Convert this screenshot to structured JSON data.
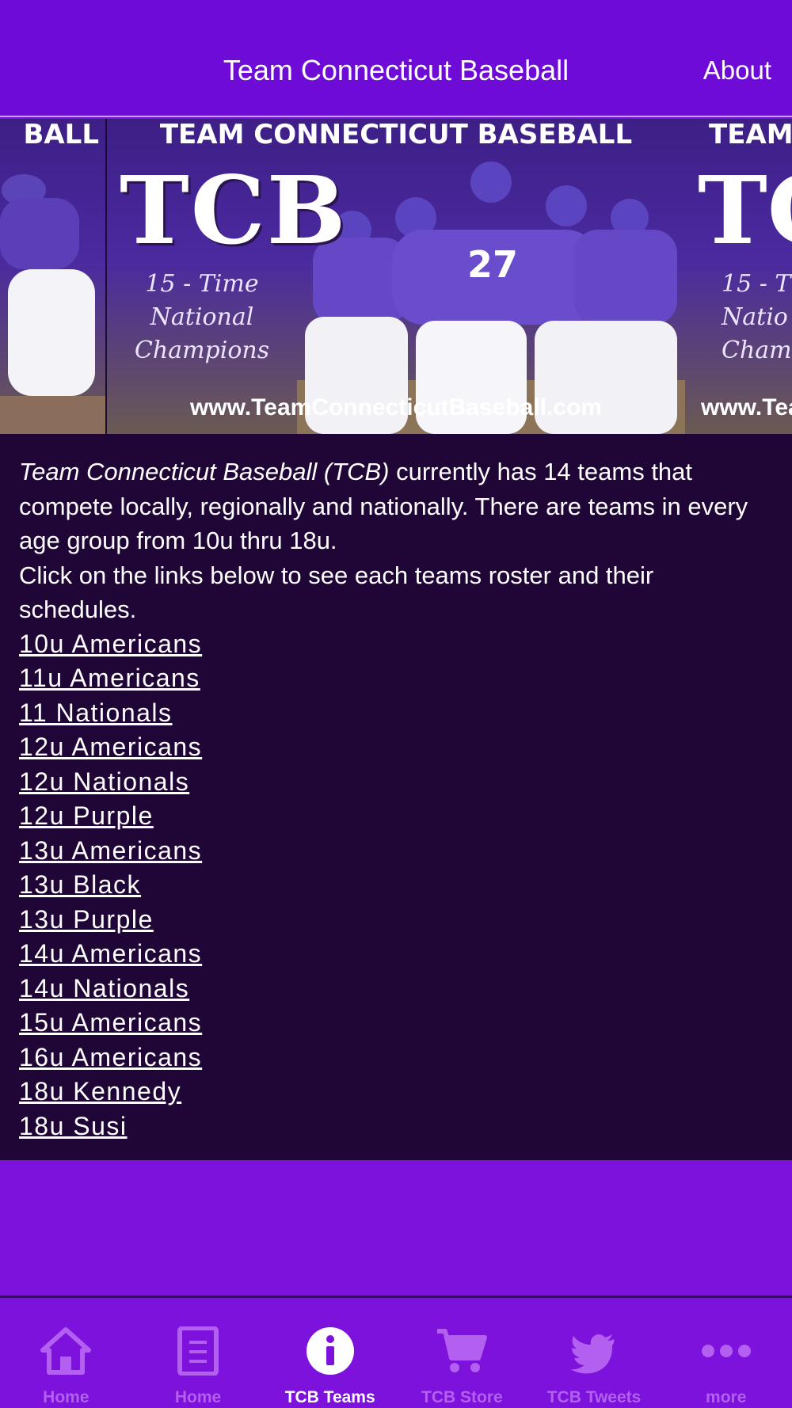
{
  "header": {
    "title": "Team Connecticut Baseball",
    "about_label": "About"
  },
  "banner": {
    "headline": "TEAM CONNECTICUT BASEBALL",
    "logo": "TCB",
    "tagline_lines": [
      "15 - Time",
      "National",
      "Champions"
    ],
    "url": "www.TeamConnecticutBaseball.com",
    "jersey_number": "27",
    "left_edge_text": "BALL",
    "right_edge_text": "TEAM",
    "right_logo": "TC",
    "right_tag_lines": [
      "15 - T",
      "Natio",
      "Champ"
    ],
    "right_url": "www.Tea"
  },
  "intro": {
    "brand": "Team Connecticut Baseball (TCB)",
    "text_1": " currently has 14 teams that compete locally, regionally and nationally. There are teams in every age group from 10u thru 18u.",
    "text_2": "Click on the links below to see each teams roster and their schedules."
  },
  "teams": [
    "10u Americans",
    "11u Americans",
    "11 Nationals",
    "12u Americans",
    "12u Nationals",
    "12u Purple",
    "13u Americans",
    "13u Black",
    "13u Purple",
    "14u Americans",
    "14u Nationals",
    "15u Americans",
    "16u Americans",
    "18u Kennedy",
    "18u Susi"
  ],
  "tabs": [
    {
      "label": "Home",
      "icon": "house-icon",
      "active": false
    },
    {
      "label": "Home",
      "icon": "document-icon",
      "active": false
    },
    {
      "label": "TCB Teams",
      "icon": "info-icon",
      "active": true
    },
    {
      "label": "TCB Store",
      "icon": "cart-icon",
      "active": false
    },
    {
      "label": "TCB Tweets",
      "icon": "twitter-bird-icon",
      "active": false
    },
    {
      "label": "more",
      "icon": "more-dots-icon",
      "active": false
    }
  ],
  "colors": {
    "header_bg": "#6f0bd6",
    "content_bg": "#200637",
    "page_bg": "#7d12dc",
    "tab_inactive": "#b35ff0",
    "tab_active": "#ffffff"
  }
}
